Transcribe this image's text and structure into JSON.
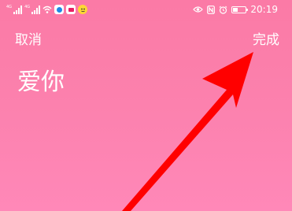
{
  "status_bar": {
    "sim1_network": "4G",
    "sim2_network": "4G",
    "battery_level": 0.4,
    "time": "20:19",
    "icons": [
      "signal-icon",
      "wifi-icon",
      "app-icon",
      "app-icon",
      "app-icon",
      "eye-icon",
      "nfc-icon",
      "alarm-icon",
      "battery-icon"
    ]
  },
  "toolbar": {
    "cancel_label": "取消",
    "done_label": "完成"
  },
  "editor": {
    "text": "爱你"
  },
  "colors": {
    "background": "#fb7fab",
    "arrow": "#ff0000",
    "foreground": "#ffffff"
  }
}
